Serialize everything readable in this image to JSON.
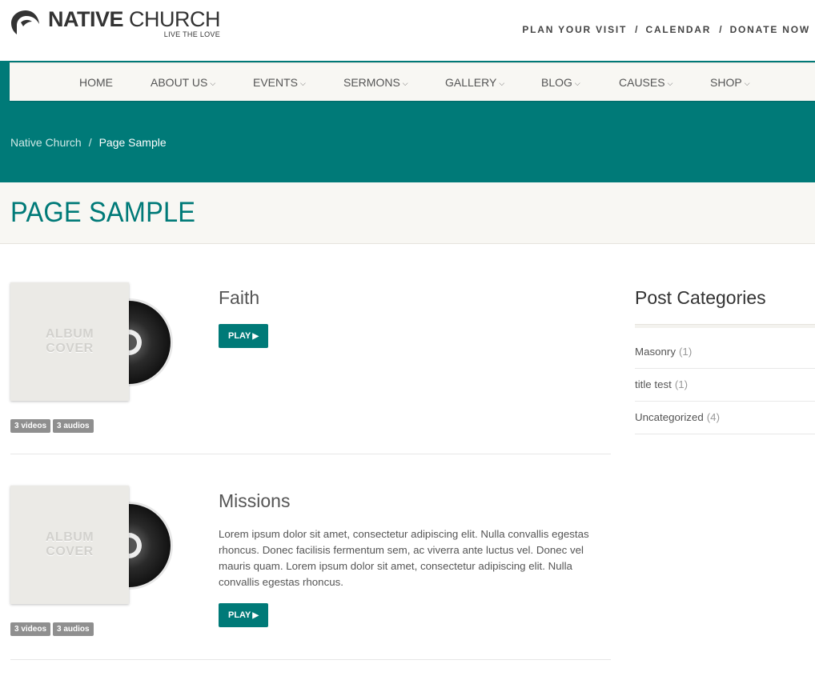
{
  "header": {
    "logo_bold": "NATIVE",
    "logo_light": "CHURCH",
    "tagline": "LIVE THE LOVE",
    "links": [
      "PLAN YOUR VISIT",
      "CALENDAR",
      "DONATE NOW"
    ],
    "link_separator": "/"
  },
  "nav": {
    "items": [
      {
        "label": "HOME",
        "has_dropdown": false
      },
      {
        "label": "ABOUT US",
        "has_dropdown": true
      },
      {
        "label": "EVENTS",
        "has_dropdown": true
      },
      {
        "label": "SERMONS",
        "has_dropdown": true
      },
      {
        "label": "GALLERY",
        "has_dropdown": true
      },
      {
        "label": "BLOG",
        "has_dropdown": true
      },
      {
        "label": "CAUSES",
        "has_dropdown": true
      },
      {
        "label": "SHOP",
        "has_dropdown": true
      }
    ],
    "caret": "⌵"
  },
  "breadcrumb": {
    "home": "Native Church",
    "separator": "/",
    "current": "Page Sample"
  },
  "page": {
    "title": "PAGE SAMPLE"
  },
  "albums": [
    {
      "cover_line1": "ALBUM",
      "cover_line2": "COVER",
      "badges": [
        "3 videos",
        "3 audios"
      ],
      "title": "Faith",
      "description": "",
      "play_label": "PLAY"
    },
    {
      "cover_line1": "ALBUM",
      "cover_line2": "COVER",
      "badges": [
        "3 videos",
        "3 audios"
      ],
      "title": "Missions",
      "description": "Lorem ipsum dolor sit amet, consectetur adipiscing elit. Nulla convallis egestas rhoncus. Donec facilisis fermentum sem, ac viverra ante luctus vel. Donec vel mauris quam. Lorem ipsum dolor sit amet, consectetur adipiscing elit. Nulla convallis egestas rhoncus.",
      "play_label": "PLAY"
    }
  ],
  "sidebar": {
    "title": "Post Categories",
    "categories": [
      {
        "name": "Masonry",
        "count": "(1)"
      },
      {
        "name": "title test",
        "count": "(1)"
      },
      {
        "name": "Uncategorized",
        "count": "(4)"
      }
    ]
  },
  "colors": {
    "brand_teal": "#007a78",
    "nav_bg": "#f8f7f3",
    "badge_gray": "#8f8f8f"
  },
  "icons": {
    "logo": "church-logo-icon",
    "play": "play-triangle-icon",
    "disc": "cd-disc-icon"
  }
}
